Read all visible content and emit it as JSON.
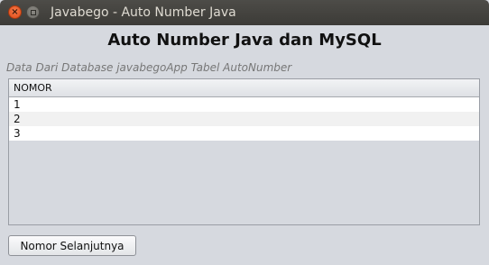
{
  "window": {
    "title": "Javabego - Auto Number Java",
    "close_glyph": "×"
  },
  "main": {
    "heading": "Auto Number Java dan MySQL",
    "caption": "Data Dari Database javabegoApp Tabel AutoNumber"
  },
  "table": {
    "columns": [
      "NOMOR"
    ],
    "rows": [
      "1",
      "2",
      "3"
    ]
  },
  "actions": {
    "next_label": "Nomor Selanjutnya"
  },
  "colors": {
    "titlebar": "#3c3b37",
    "close_button": "#df4a16",
    "window_bg": "#d6d9df"
  }
}
